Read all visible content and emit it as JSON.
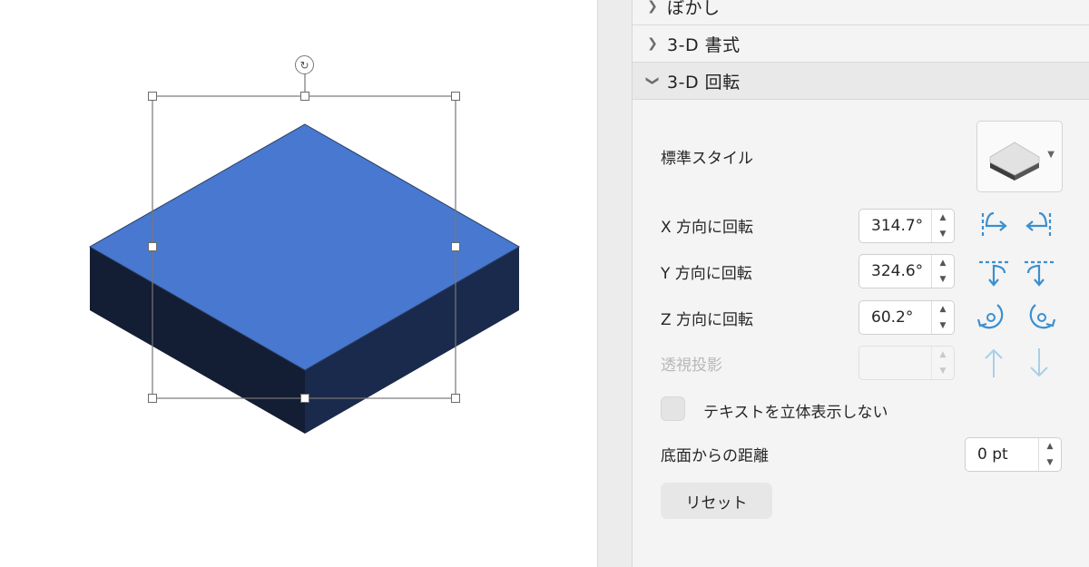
{
  "panel": {
    "sections": [
      {
        "title": "ぼかし",
        "expanded": false
      },
      {
        "title": "3-D 書式",
        "expanded": false
      },
      {
        "title": "3-D 回転",
        "expanded": true
      }
    ],
    "rotation": {
      "preset_label": "標準スタイル",
      "x_label": "X 方向に回転",
      "x_value": "314.7°",
      "y_label": "Y 方向に回転",
      "y_value": "324.6°",
      "z_label": "Z 方向に回転",
      "z_value": "60.2°",
      "perspective_label": "透視投影",
      "perspective_value": "",
      "keep_text_flat_label": "テキストを立体表示しない",
      "distance_label": "底面からの距離",
      "distance_value": "0 pt",
      "reset_label": "リセット"
    }
  },
  "colors": {
    "shape_top": "#4878cf",
    "shape_left": "#131d33",
    "shape_right": "#1a2a4c",
    "icon_blue": "#3a8fd0",
    "icon_blue_disabled": "#a9cfe8"
  }
}
